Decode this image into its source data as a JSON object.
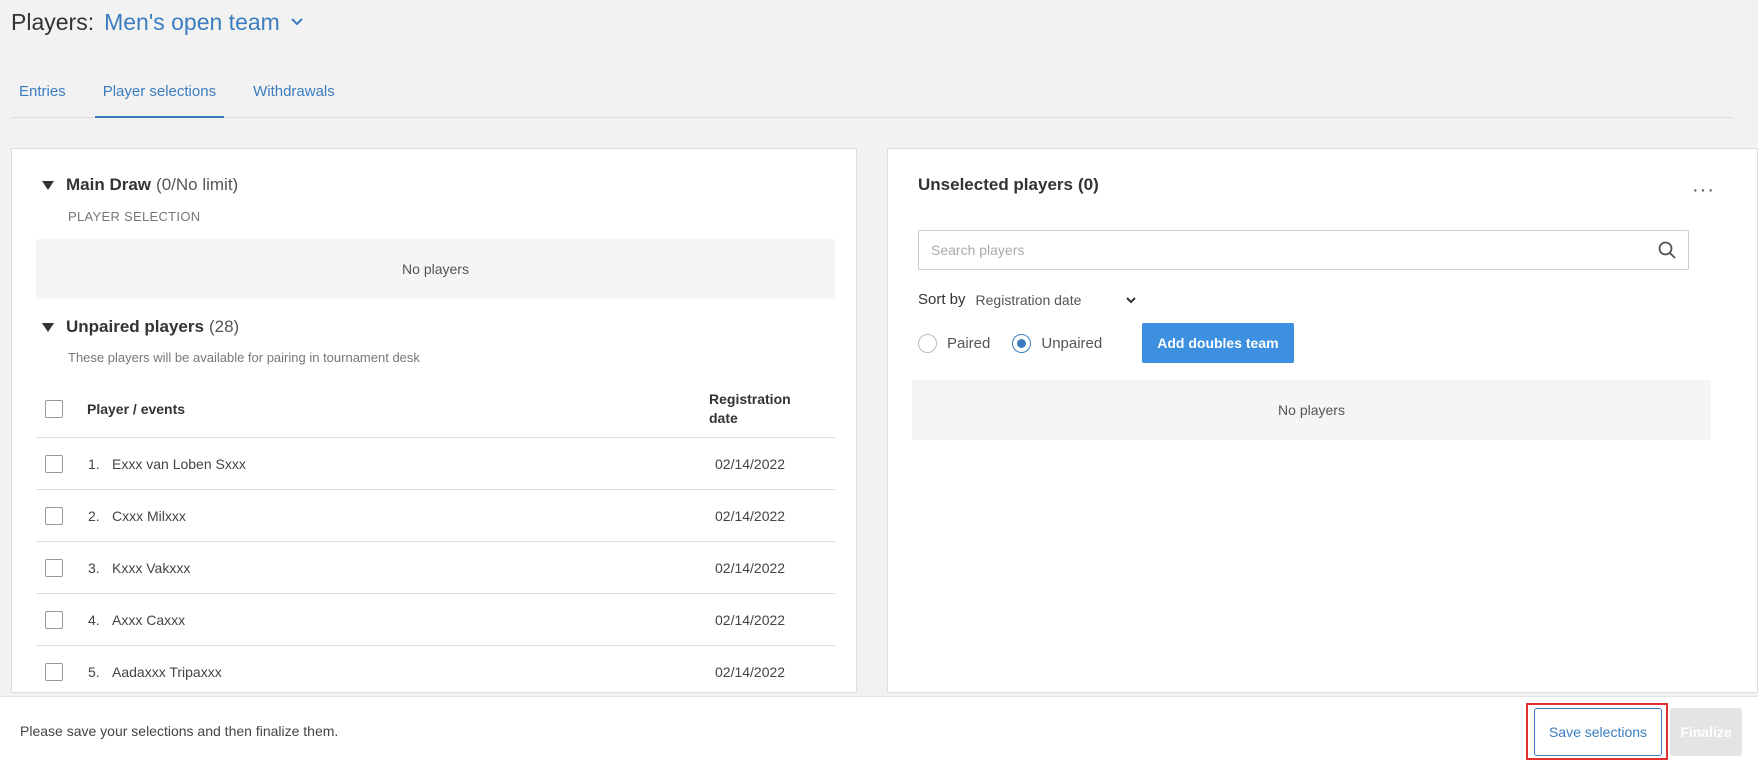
{
  "header": {
    "label": "Players:",
    "team": "Men's open team"
  },
  "tabs": [
    {
      "label": "Entries",
      "active": false
    },
    {
      "label": "Player selections",
      "active": true
    },
    {
      "label": "Withdrawals",
      "active": false
    }
  ],
  "main_draw": {
    "title": "Main Draw",
    "count": "(0/No limit)",
    "caption": "PLAYER SELECTION",
    "empty_text": "No players"
  },
  "unpaired": {
    "title": "Unpaired players",
    "count": "(28)",
    "caption": "These players will be available for pairing in tournament desk",
    "columns": {
      "player": "Player / events",
      "date_line1": "Registration",
      "date_line2": "date"
    },
    "rows": [
      {
        "num": "1.",
        "name": "Exxx van Loben Sxxx",
        "date": "02/14/2022"
      },
      {
        "num": "2.",
        "name": "Cxxx Milxxx",
        "date": "02/14/2022"
      },
      {
        "num": "3.",
        "name": "Kxxx Vakxxx",
        "date": "02/14/2022"
      },
      {
        "num": "4.",
        "name": "Axxx Caxxx",
        "date": "02/14/2022"
      },
      {
        "num": "5.",
        "name": "Aadaxxx Tripaxxx",
        "date": "02/14/2022"
      }
    ]
  },
  "unselected": {
    "title": "Unselected players",
    "count": "(0)",
    "more": "···",
    "search_placeholder": "Search players",
    "sort_label": "Sort by",
    "sort_value": "Registration date",
    "radio_paired": "Paired",
    "radio_unpaired": "Unpaired",
    "selected_radio": "Unpaired",
    "add_button": "Add doubles team",
    "empty_text": "No players"
  },
  "footer": {
    "message": "Please save your selections and then finalize them.",
    "save_label": "Save selections",
    "finalize_label": "Finalize"
  },
  "colors": {
    "accent": "#3b7dbf",
    "button_blue": "#3d8fe0",
    "highlight": "#e03030"
  },
  "icons": {
    "team_dropdown": "chevron-down-icon",
    "search": "search-icon",
    "sort_dropdown": "chevron-down-icon",
    "section_toggle": "triangle-down-icon"
  }
}
